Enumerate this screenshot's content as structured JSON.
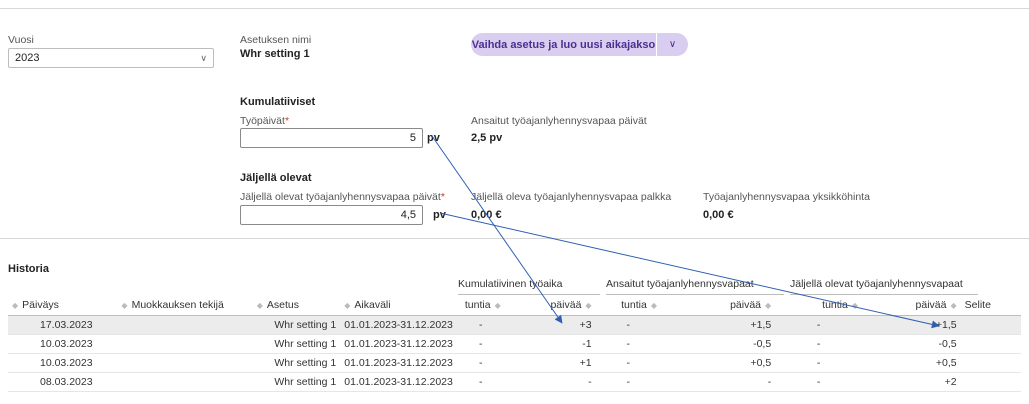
{
  "year": {
    "label": "Vuosi",
    "value": "2023"
  },
  "setting": {
    "label": "Asetuksen nimi",
    "value": "Whr setting 1"
  },
  "change_button": {
    "label": "Vaihda asetus ja luo uusi aikajakso"
  },
  "cumulative": {
    "title": "Kumulatiiviset",
    "workdays_label": "Työpäivät",
    "workdays_value": "5",
    "workdays_unit": "pv",
    "earned_label": "Ansaitut työajanlyhennysvapaa päivät",
    "earned_value": "2,5 pv"
  },
  "remaining": {
    "title": "Jäljellä olevat",
    "days_label": "Jäljellä olevat työajanlyhennysvapaa päivät",
    "days_value": "4,5",
    "days_unit": "pv",
    "salary_label": "Jäljellä oleva työajanlyhennysvapaa palkka",
    "salary_value": "0,00 €",
    "unit_price_label": "Työajanlyhennysvapaa yksikköhinta",
    "unit_price_value": "0,00 €"
  },
  "history": {
    "title": "Historia",
    "group_headers": {
      "cumulative": "Kumulatiivinen työaika",
      "earned": "Ansaitut työajanlyhennysvapaat",
      "remaining": "Jäljellä olevat työajanlyhennysvapaat"
    },
    "columns": {
      "date": "Päiväys",
      "editor": "Muokkauksen tekijä",
      "setting": "Asetus",
      "period": "Aikaväli",
      "hours": "tuntia",
      "days": "päivää",
      "note": "Selite"
    },
    "rows": [
      {
        "date": "17.03.2023",
        "editor": "",
        "setting": "Whr setting 1",
        "period": "01.01.2023-31.12.2023",
        "cum_h": "-",
        "cum_d": "+3",
        "earn_h": "-",
        "earn_d": "+1,5",
        "rem_h": "-",
        "rem_d": "+1,5",
        "note": ""
      },
      {
        "date": "10.03.2023",
        "editor": "",
        "setting": "Whr setting 1",
        "period": "01.01.2023-31.12.2023",
        "cum_h": "-",
        "cum_d": "-1",
        "earn_h": "-",
        "earn_d": "-0,5",
        "rem_h": "-",
        "rem_d": "-0,5",
        "note": ""
      },
      {
        "date": "10.03.2023",
        "editor": "",
        "setting": "Whr setting 1",
        "period": "01.01.2023-31.12.2023",
        "cum_h": "-",
        "cum_d": "+1",
        "earn_h": "-",
        "earn_d": "+0,5",
        "rem_h": "-",
        "rem_d": "+0,5",
        "note": ""
      },
      {
        "date": "08.03.2023",
        "editor": "",
        "setting": "Whr setting 1",
        "period": "01.01.2023-31.12.2023",
        "cum_h": "-",
        "cum_d": "-",
        "earn_h": "-",
        "earn_d": "-",
        "rem_h": "-",
        "rem_d": "+2",
        "note": ""
      }
    ]
  },
  "colors": {
    "accent_bg": "#d9cdf0",
    "accent_fg": "#4b2f8f",
    "arrow": "#2f5fb3"
  }
}
